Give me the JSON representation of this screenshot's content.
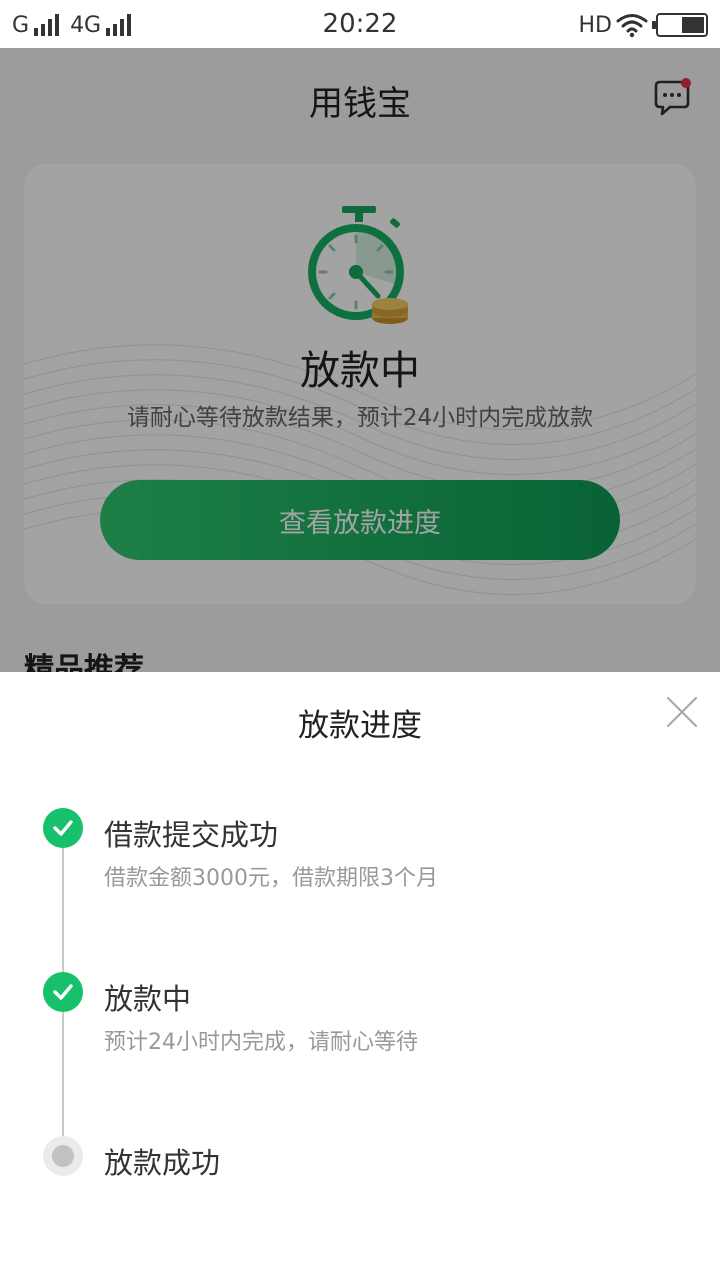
{
  "status_bar": {
    "carrier1": "G",
    "carrier2": "4G",
    "time": "20:22",
    "hd": "HD",
    "icons": [
      "signal-icon",
      "wifi-icon",
      "battery-icon"
    ]
  },
  "app": {
    "title": "用钱宝",
    "message_icon": "chat-bubble-icon",
    "notification_dot_color": "#e0303f",
    "status_title": "放款中",
    "status_desc": "请耐心等待放款结果，预计24小时内完成放款",
    "progress_button": "查看放款进度",
    "section_title": "精品推荐"
  },
  "sheet": {
    "title": "放款进度",
    "close_icon": "close-icon",
    "steps": [
      {
        "title": "借款提交成功",
        "desc": "借款金额3000元，借款期限3个月",
        "state": "done"
      },
      {
        "title": "放款中",
        "desc": "预计24小时内完成，请耐心等待",
        "state": "done"
      },
      {
        "title": "放款成功",
        "state": "pending"
      }
    ]
  },
  "colors": {
    "accent_green": "#17c06a",
    "button_gradient_start": "#2ec76f",
    "button_gradient_end": "#0e9a55",
    "coin_gold": "#e8b84a"
  }
}
